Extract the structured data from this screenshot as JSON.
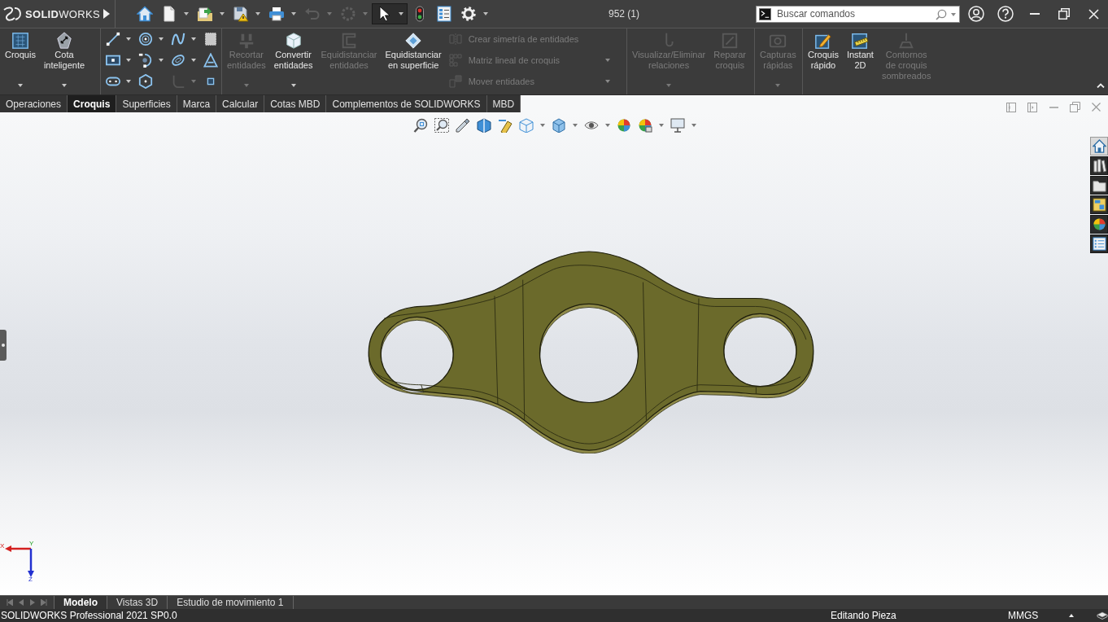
{
  "title_bar": {
    "logo": "**SOLID**WORKS",
    "quick_access": [
      {
        "dropdown": false,
        "disabled": false,
        "pressed": false
      },
      {
        "dropdown": true,
        "disabled": false,
        "pressed": false
      },
      {
        "dropdown": true,
        "disabled": false,
        "pressed": false
      },
      {
        "dropdown": true,
        "disabled": false,
        "pressed": false
      },
      {
        "dropdown": true,
        "disabled": false,
        "pressed": false
      },
      {
        "dropdown": true,
        "disabled": true,
        "pressed": false
      },
      {
        "dropdown": true,
        "disabled": true,
        "pressed": false
      },
      {
        "dropdown": true,
        "disabled": false,
        "pressed": true
      },
      {
        "dropdown": false,
        "disabled": false,
        "pressed": false
      },
      {
        "dropdown": false,
        "disabled": false,
        "pressed": false
      },
      {
        "dropdown": true,
        "disabled": false,
        "pressed": false
      }
    ],
    "document_title": "952 (1)",
    "search": {
      "placeholder": "Buscar comandos"
    }
  },
  "ribbon": {
    "groups": [
      {
        "items": [
          {
            "kind": "large",
            "label": "Croquis",
            "disabled": false,
            "dropdown": true
          },
          {
            "kind": "large",
            "label": "Cota\ninteligente",
            "disabled": false,
            "dropdown": true
          }
        ]
      },
      {
        "items": [
          {
            "kind": "grid",
            "cells": [
              {
                "dropdown": true,
                "disabled": false
              },
              {
                "dropdown": true,
                "disabled": false
              },
              {
                "dropdown": true,
                "disabled": false
              },
              {
                "dropdown": false,
                "disabled": false
              },
              {
                "dropdown": true,
                "disabled": false
              },
              {
                "dropdown": true,
                "disabled": false
              },
              {
                "dropdown": true,
                "disabled": false
              },
              {
                "dropdown": false,
                "disabled": false
              },
              {
                "dropdown": true,
                "disabled": false
              },
              {
                "dropdown": false,
                "disabled": false
              },
              {
                "dropdown": true,
                "disabled": true
              },
              {
                "dropdown": false,
                "disabled": false
              }
            ]
          }
        ]
      },
      {
        "items": [
          {
            "kind": "large",
            "label": "Recortar\nentidades",
            "disabled": true,
            "dropdown": true
          },
          {
            "kind": "large",
            "label": "Convertir\nentidades",
            "disabled": false,
            "dropdown": true
          },
          {
            "kind": "large",
            "label": "Equidistanciar\nentidades",
            "disabled": true,
            "dropdown": false
          },
          {
            "kind": "large",
            "label": "Equidistanciar\nen superficie",
            "disabled": false,
            "dropdown": false
          },
          {
            "kind": "list",
            "rows": [
              {
                "label": "Crear simetría de entidades",
                "disabled": true,
                "dropdown": false
              },
              {
                "label": "Matriz lineal de croquis",
                "disabled": true,
                "dropdown": true
              },
              {
                "label": "Mover entidades",
                "disabled": true,
                "dropdown": true
              }
            ]
          }
        ]
      },
      {
        "items": [
          {
            "kind": "large",
            "label": "Visualizar/Eliminar\nrelaciones",
            "disabled": true,
            "dropdown": true
          },
          {
            "kind": "large",
            "label": "Reparar\ncroquis",
            "disabled": true,
            "dropdown": false
          }
        ]
      },
      {
        "items": [
          {
            "kind": "large",
            "label": "Capturas\nrápidas",
            "disabled": true,
            "dropdown": true
          }
        ]
      },
      {
        "items": [
          {
            "kind": "large",
            "label": "Croquis\nrápido",
            "disabled": false,
            "dropdown": false
          },
          {
            "kind": "large",
            "label": "Instant\n2D",
            "disabled": false,
            "dropdown": false
          },
          {
            "kind": "large",
            "label": "Contornos\nde croquis\nsombreados",
            "disabled": true,
            "dropdown": false
          }
        ]
      }
    ]
  },
  "command_tabs": [
    {
      "label": "Operaciones",
      "selected": false
    },
    {
      "label": "Croquis",
      "selected": true
    },
    {
      "label": "Superficies",
      "selected": false
    },
    {
      "label": "Marca",
      "selected": false
    },
    {
      "label": "Calcular",
      "selected": false
    },
    {
      "label": "Cotas MBD",
      "selected": false
    },
    {
      "label": "Complementos de SOLIDWORKS",
      "selected": false
    },
    {
      "label": "MBD",
      "selected": false
    }
  ],
  "heads_up_toolbar": [
    {
      "dropdown": false
    },
    {
      "dropdown": false
    },
    {
      "dropdown": false
    },
    {
      "dropdown": false
    },
    {
      "dropdown": false
    },
    {
      "dropdown": true
    },
    {
      "dropdown": true
    },
    {
      "dropdown": true
    },
    {
      "dropdown": false
    },
    {
      "dropdown": true
    },
    {
      "dropdown": true
    }
  ],
  "task_pane": [
    {
      "selected": true
    },
    {
      "selected": false
    },
    {
      "selected": false
    },
    {
      "selected": false
    },
    {
      "selected": false
    },
    {
      "selected": false
    }
  ],
  "triad": {
    "x_label": "X",
    "y_label": "Y",
    "z_label": "Z"
  },
  "bottom_tabs": [
    {
      "label": "Modelo",
      "selected": true
    },
    {
      "label": "Vistas 3D",
      "selected": false
    },
    {
      "label": "Estudio de movimiento 1",
      "selected": false
    }
  ],
  "status_bar": {
    "product": "SOLIDWORKS Professional 2021 SP0.0",
    "mode": "Editando Pieza",
    "units": "MMGS"
  }
}
